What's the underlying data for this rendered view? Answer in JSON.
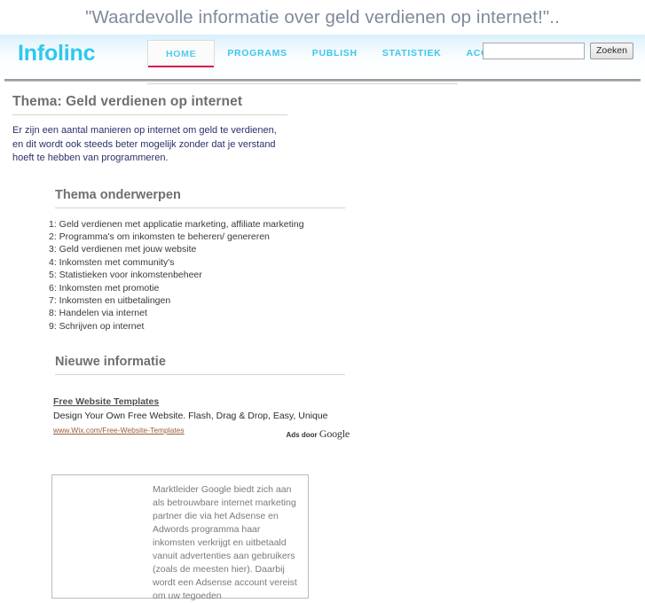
{
  "banner": {
    "tagline": "\"Waardevolle informatie over geld verdienen op internet!\".."
  },
  "header": {
    "logo": "Infolinc",
    "nav": [
      {
        "label": "HOME",
        "active": true
      },
      {
        "label": "PROGRAMS",
        "active": false
      },
      {
        "label": "PUBLISH",
        "active": false
      },
      {
        "label": "STATISTIEK",
        "active": false
      },
      {
        "label": "ACCOUNT",
        "active": false
      }
    ],
    "search": {
      "value": "",
      "placeholder": "",
      "button_label": "Zoeken"
    },
    "accent_color": "#3ec6ec",
    "active_underline_color": "#d8174f"
  },
  "main": {
    "page_title": "Thema: Geld verdienen op internet",
    "intro": "Er zijn een aantal manieren op internet om geld te verdienen, en dit wordt ook steeds beter mogelijk zonder dat je verstand hoeft te hebben van programmeren.",
    "topics_heading": "Thema onderwerpen",
    "topics": [
      "1: Geld verdienen met applicatie marketing, affiliate marketing",
      "2: Programma's om inkomsten te beheren/ genereren",
      "3: Geld verdienen met jouw website",
      "4: Inkomsten met community's",
      "5: Statistieken voor inkomstenbeheer",
      "6: Inkomsten met promotie",
      "7: Inkomsten en uitbetalingen",
      "8: Handelen via internet",
      "9: Schrijven op internet"
    ],
    "news_heading": "Nieuwe informatie",
    "ad": {
      "title": "Free Website Templates",
      "description": "Design Your Own Free Website. Flash, Drag & Drop, Easy, Unique",
      "url": "www.Wix.com/Free-Website-Templates",
      "ads_by_prefix": "Ads door",
      "ads_by_brand": "Google"
    },
    "info_box": {
      "text": "Marktleider Google biedt zich aan als betrouwbare internet marketing partner die via het Adsense en Adwords programma haar inkomsten verkrijgt en uitbetaald vanuit advertenties aan gebruikers (zoals de meesten hier). Daarbij wordt een Adsense account vereist om uw tegoeden"
    }
  }
}
